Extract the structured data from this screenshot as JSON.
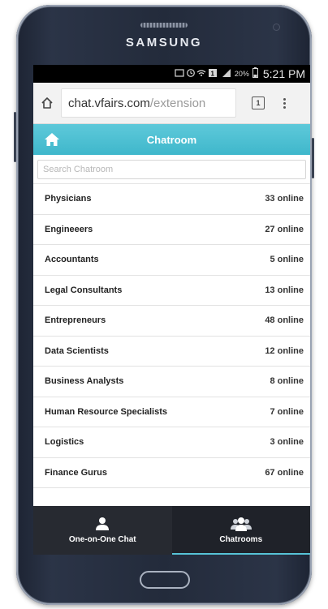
{
  "device": {
    "brand": "SAMSUNG"
  },
  "status_bar": {
    "battery": "20%",
    "time": "5:21 PM"
  },
  "browser": {
    "url_host": "chat.vfairs.com",
    "url_path": "/extension",
    "tab_count": "1"
  },
  "app": {
    "header_title": "Chatroom",
    "search_placeholder": "Search Chatroom"
  },
  "rooms": [
    {
      "name": "Physicians",
      "online": "33 online"
    },
    {
      "name": "Engineeers",
      "online": "27 online"
    },
    {
      "name": "Accountants",
      "online": "5 online"
    },
    {
      "name": "Legal Consultants",
      "online": "13 online"
    },
    {
      "name": "Entrepreneurs",
      "online": "48 online"
    },
    {
      "name": "Data Scientists",
      "online": "12 online"
    },
    {
      "name": "Business Analysts",
      "online": "8 online"
    },
    {
      "name": "Human Resource Specialists",
      "online": "7 online"
    },
    {
      "name": "Logistics",
      "online": "3 online"
    },
    {
      "name": "Finance Gurus",
      "online": "67 online"
    }
  ],
  "bottom_nav": {
    "one_on_one_label": "One-on-One Chat",
    "chatrooms_label": "Chatrooms",
    "active": "chatrooms"
  },
  "colors": {
    "header_accent": "#45bccf",
    "nav_background": "#272a31"
  },
  "icons": {
    "browser_home": "home-outline-icon",
    "app_home": "home-icon",
    "one_on_one": "person-icon",
    "chatrooms": "group-icon"
  }
}
